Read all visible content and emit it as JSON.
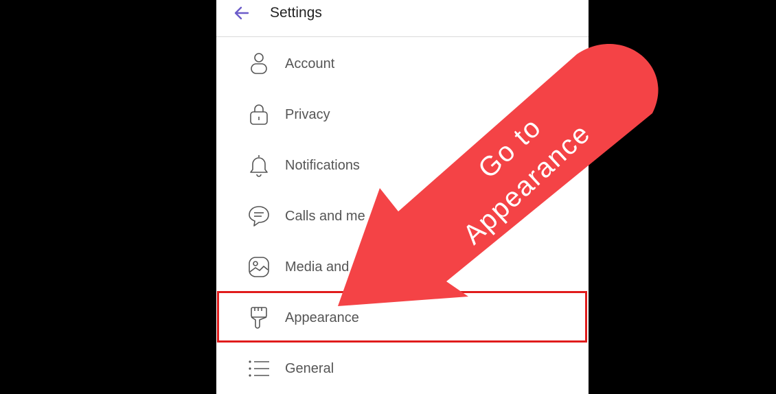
{
  "header": {
    "title": "Settings"
  },
  "items": [
    {
      "label": "Account",
      "icon": "person-icon"
    },
    {
      "label": "Privacy",
      "icon": "lock-icon"
    },
    {
      "label": "Notifications",
      "icon": "bell-icon"
    },
    {
      "label": "Calls and me",
      "icon": "chat-bubble-icon"
    },
    {
      "label": "Media and",
      "icon": "image-icon"
    },
    {
      "label": "Appearance",
      "icon": "paintbrush-icon"
    },
    {
      "label": "General",
      "icon": "list-icon"
    }
  ],
  "callout": {
    "line1": "Go to",
    "line2": "Appearance",
    "color": "#f44346"
  },
  "colors": {
    "accent": "#6b5bc9",
    "highlight": "#e01c1c"
  }
}
